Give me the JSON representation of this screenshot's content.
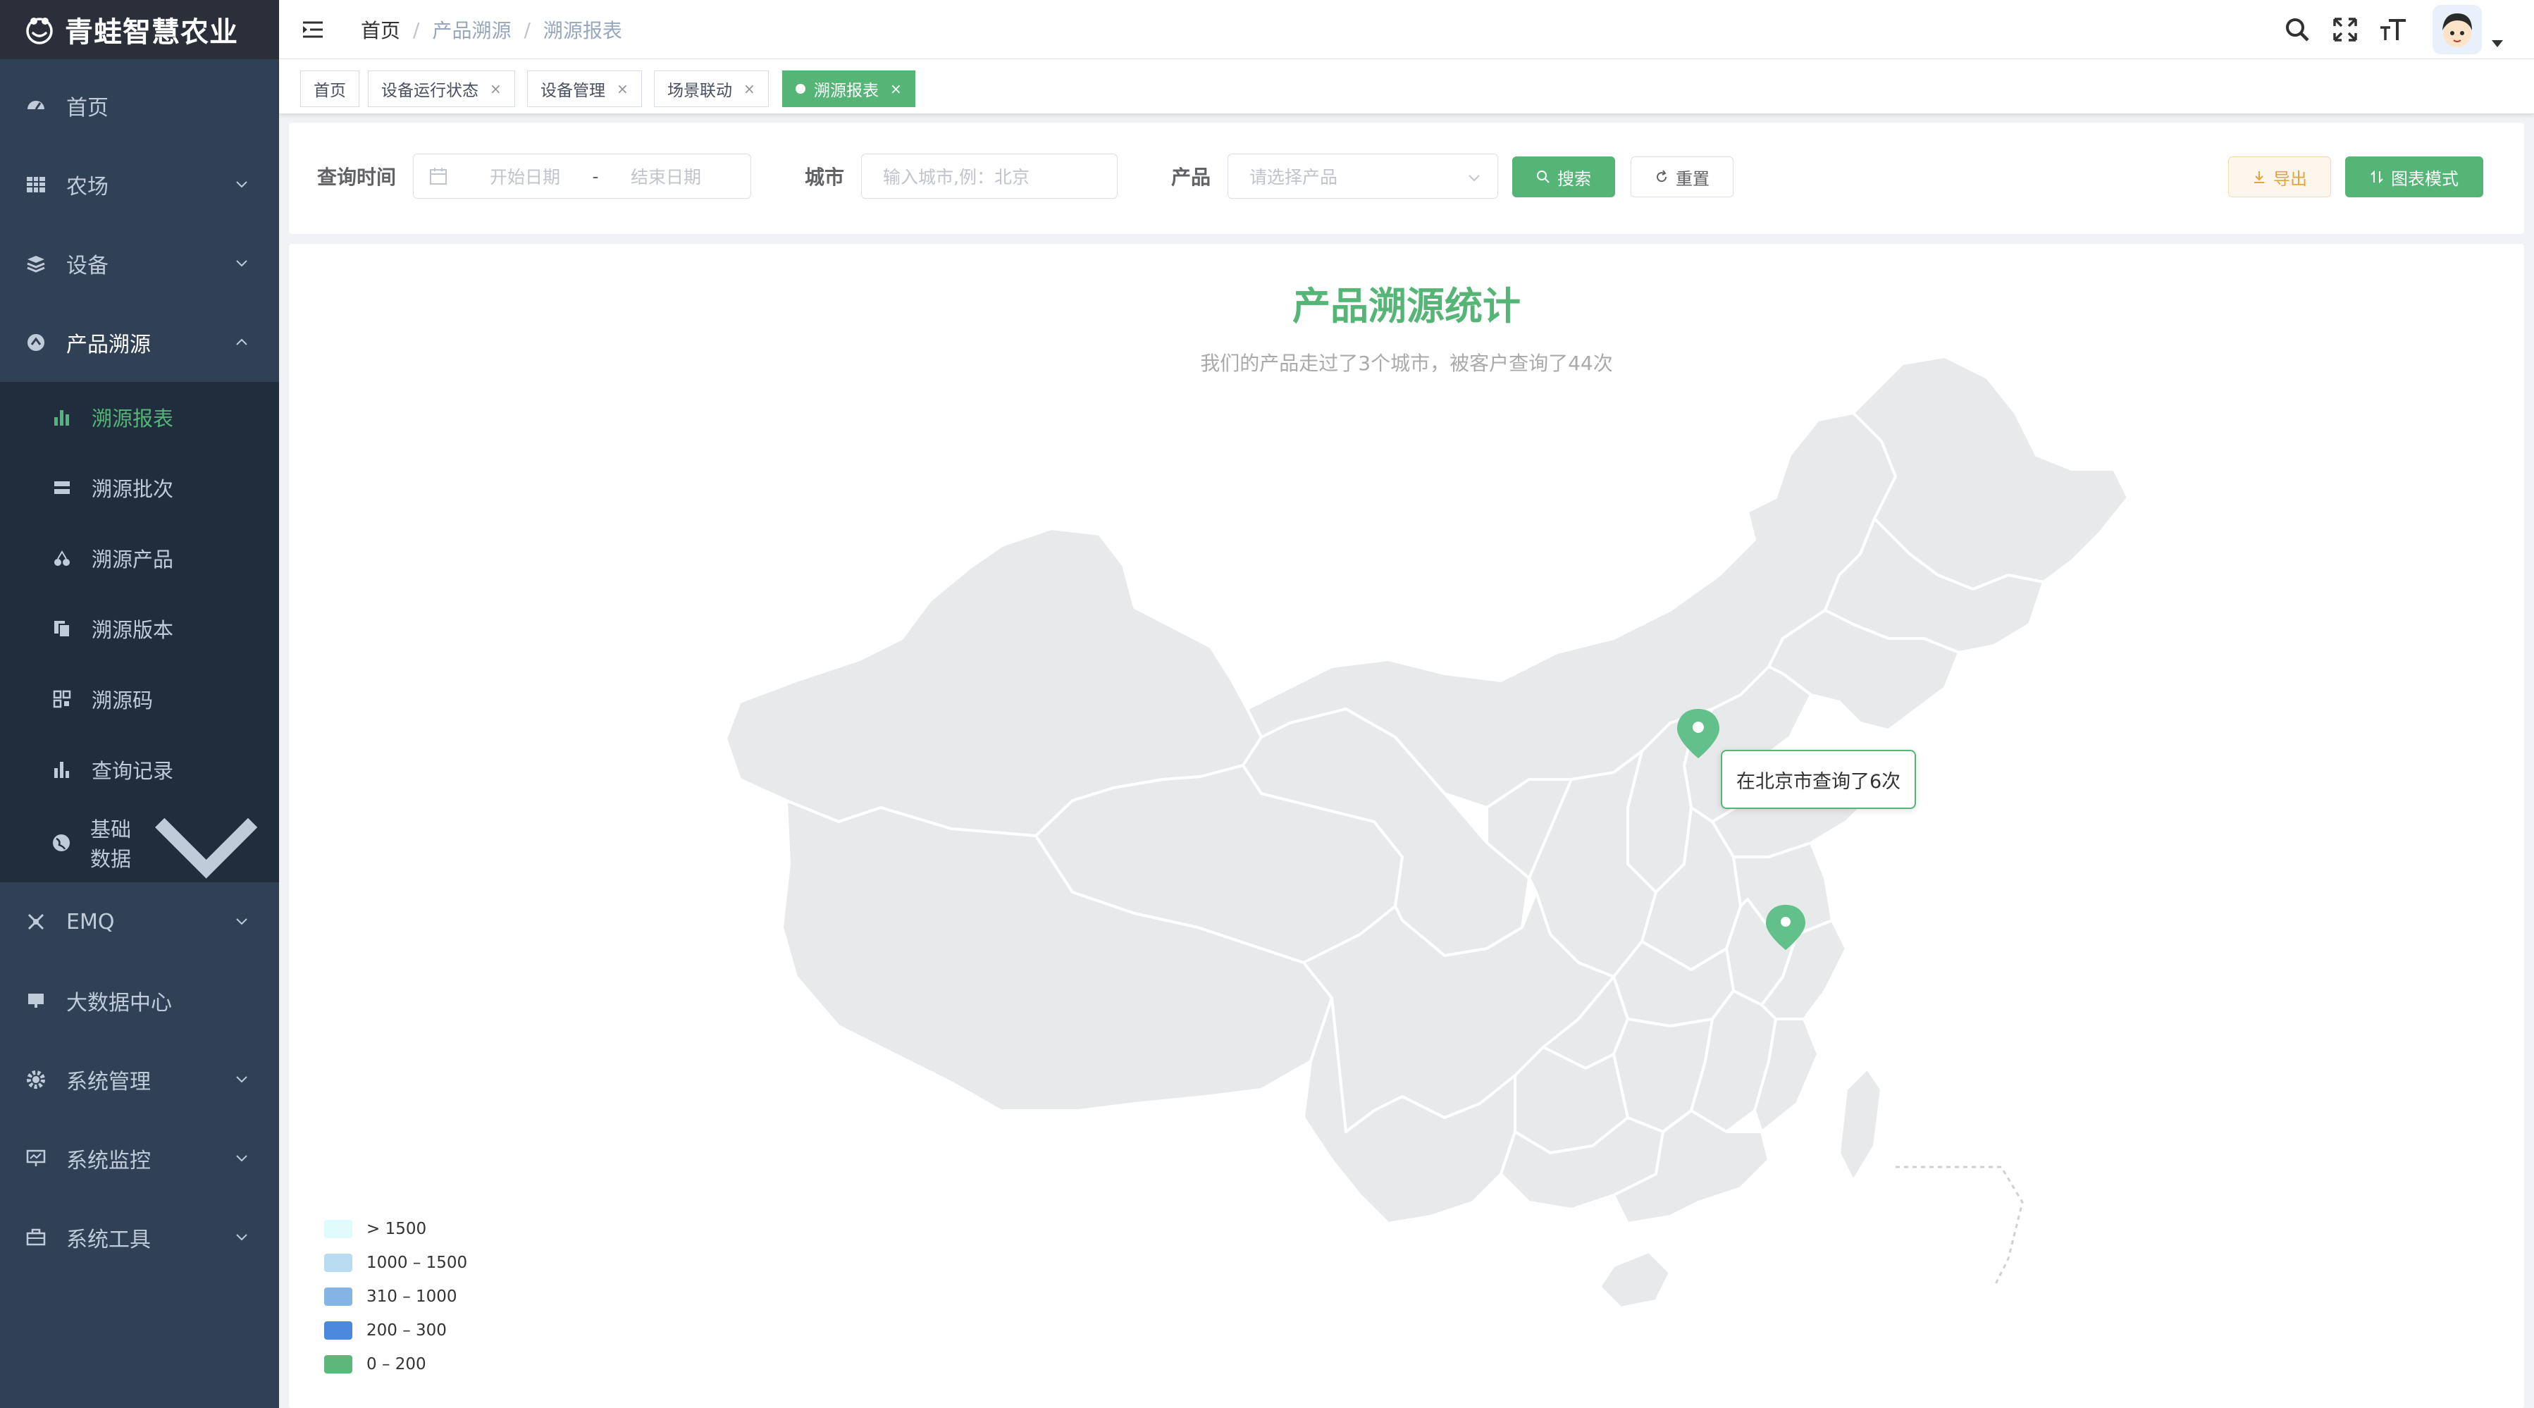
{
  "app": {
    "title": "青蛙智慧农业"
  },
  "sidebar": {
    "items": [
      {
        "label": "首页",
        "icon": "dashboard-icon"
      },
      {
        "label": "农场",
        "icon": "table-icon"
      },
      {
        "label": "设备",
        "icon": "layers-icon"
      },
      {
        "label": "产品溯源",
        "icon": "trace-icon",
        "expanded": true
      },
      {
        "label": "EMQ",
        "icon": "network-icon"
      },
      {
        "label": "大数据中心",
        "icon": "screen-icon"
      },
      {
        "label": "系统管理",
        "icon": "gear-icon"
      },
      {
        "label": "系统监控",
        "icon": "monitor-icon"
      },
      {
        "label": "系统工具",
        "icon": "toolbox-icon"
      }
    ],
    "sub_items": [
      {
        "label": "溯源报表",
        "icon": "bar-chart-icon",
        "active": true
      },
      {
        "label": "溯源批次",
        "icon": "server-icon"
      },
      {
        "label": "溯源产品",
        "icon": "cherry-icon"
      },
      {
        "label": "溯源版本",
        "icon": "copy-icon"
      },
      {
        "label": "溯源码",
        "icon": "qrcode-icon"
      },
      {
        "label": "查询记录",
        "icon": "chart-icon"
      },
      {
        "label": "基础数据",
        "icon": "globe-icon"
      }
    ]
  },
  "navbar": {
    "breadcrumb": [
      "首页",
      "产品溯源",
      "溯源报表"
    ]
  },
  "tags": [
    {
      "label": "首页",
      "closable": false
    },
    {
      "label": "设备运行状态",
      "closable": true
    },
    {
      "label": "设备管理",
      "closable": true
    },
    {
      "label": "场景联动",
      "closable": true
    },
    {
      "label": "溯源报表",
      "closable": true,
      "active": true
    }
  ],
  "search": {
    "time_label": "查询时间",
    "start_placeholder": "开始日期",
    "range_separator": "-",
    "end_placeholder": "结束日期",
    "city_label": "城市",
    "city_placeholder": "输入城市,例：北京",
    "product_label": "产品",
    "product_placeholder": "请选择产品",
    "search_button": "搜索",
    "reset_button": "重置",
    "export_button": "导出",
    "chart_mode_button": "图表模式"
  },
  "map": {
    "title": "产品溯源统计",
    "subtitle": "我们的产品走过了3个城市，被客户查询了44次",
    "tooltip": "在北京市查询了6次",
    "markers": [
      {
        "city": "北京市"
      },
      {
        "city": "上海市"
      }
    ],
    "legend": [
      {
        "label": "> 1500",
        "color": "#e0fbfc"
      },
      {
        "label": "1000 – 1500",
        "color": "#b9dcf0"
      },
      {
        "label": "310 – 1000",
        "color": "#85b3e3"
      },
      {
        "label": "200 – 300",
        "color": "#4a89dc"
      },
      {
        "label": "0 – 200",
        "color": "#5cb87a"
      }
    ]
  },
  "colors": {
    "primary": "#55b576",
    "sidebar_bg": "#304156",
    "submenu_bg": "#1f2d3d",
    "map_fill": "#e8e9eb",
    "map_border": "#ffffff"
  }
}
